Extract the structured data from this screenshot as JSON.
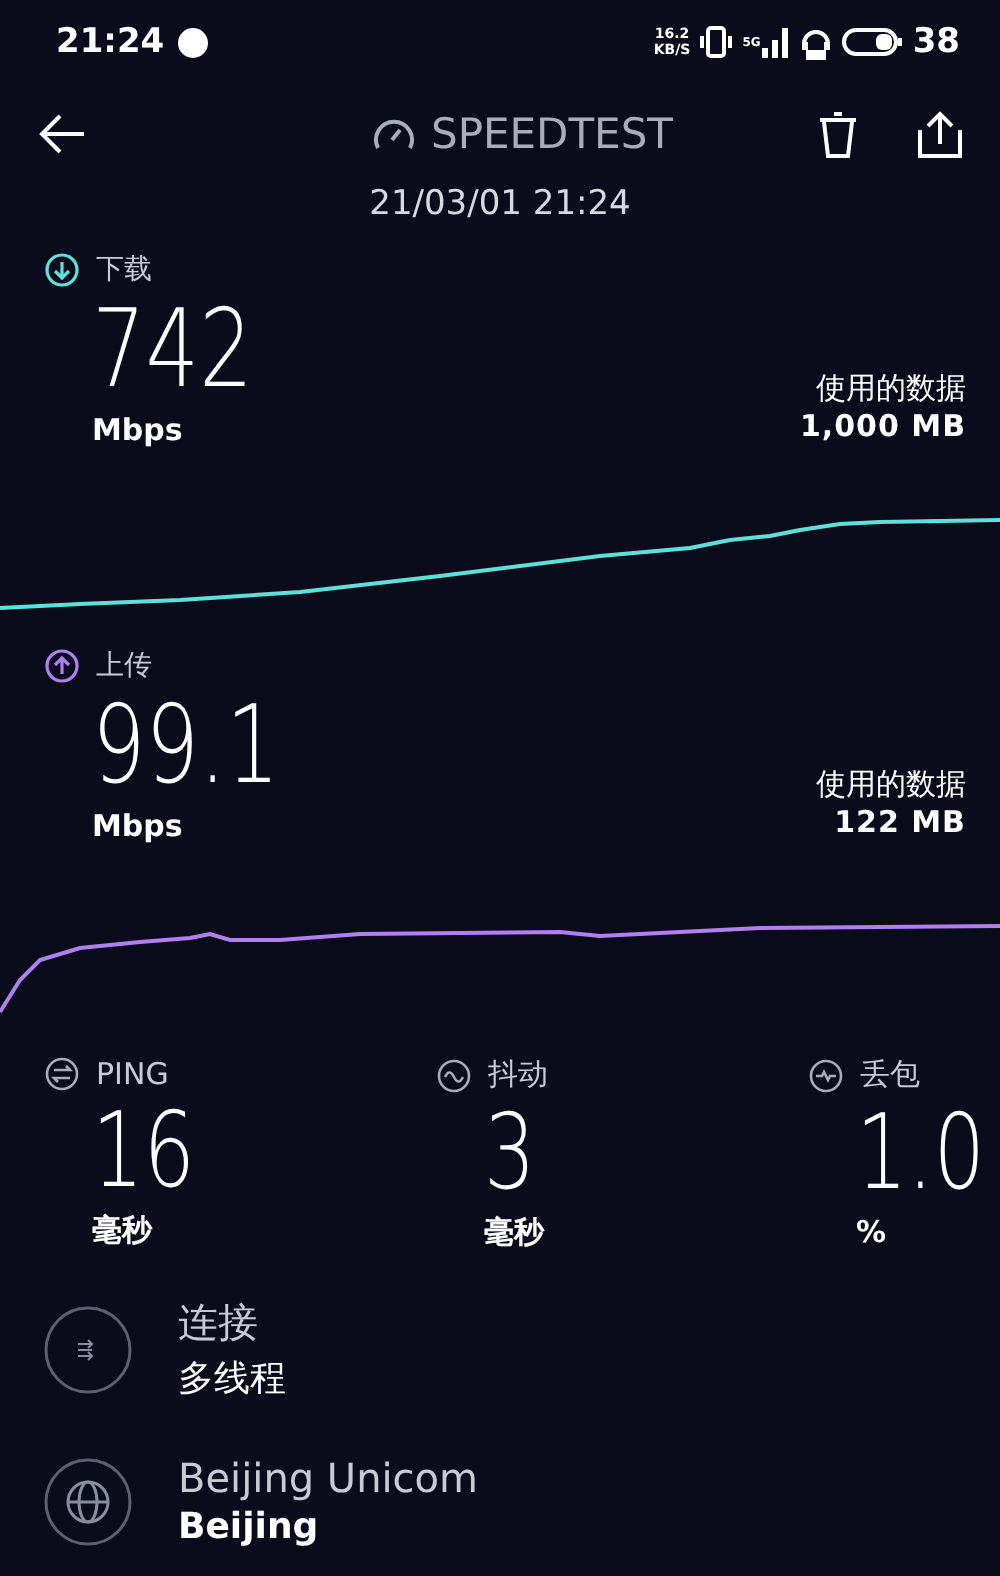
{
  "status_bar": {
    "time": "21:24",
    "net_speed_value": "16.2",
    "net_speed_unit": "KB/S",
    "network": "5G",
    "battery": "38"
  },
  "header": {
    "title": "SPEEDTEST",
    "date": "21/03/01 21:24"
  },
  "speeds": [
    {
      "kind": "download",
      "label": "下载",
      "value": "742",
      "unit": "Mbps",
      "data_label": "使用的数据",
      "data_value": "1,000 MB",
      "color": "#5ee0dc"
    },
    {
      "kind": "upload",
      "label": "上传",
      "value": "99.1",
      "unit": "Mbps",
      "data_label": "使用的数据",
      "data_value": "122 MB",
      "color": "#b07ff0"
    }
  ],
  "metrics": [
    {
      "kind": "ping",
      "label": "PING",
      "value": "16",
      "unit": "毫秒"
    },
    {
      "kind": "jitter",
      "label": "抖动",
      "value": "3",
      "unit": "毫秒"
    },
    {
      "kind": "loss",
      "label": "丢包",
      "value": "1.0",
      "unit": "%"
    }
  ],
  "details": [
    {
      "kind": "connections",
      "title": "连接",
      "subtitle": "多线程"
    },
    {
      "kind": "server",
      "title": "Beijing Unicom",
      "subtitle": "Beijing"
    }
  ]
}
